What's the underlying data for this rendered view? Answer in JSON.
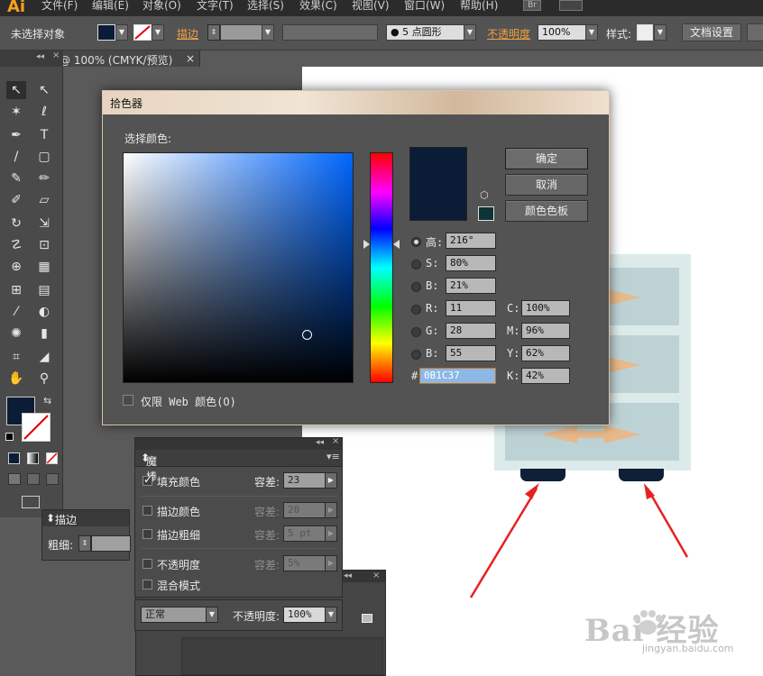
{
  "app": {
    "logo": "Ai"
  },
  "menu": [
    "文件(F)",
    "编辑(E)",
    "对象(O)",
    "文字(T)",
    "选择(S)",
    "效果(C)",
    "视图(V)",
    "窗口(W)",
    "帮助(H)"
  ],
  "bridge_button": "Br",
  "control_bar": {
    "selection_status": "未选择对象",
    "stroke_label": "描边",
    "brush_size_value": "5",
    "brush_shape": "点圆形",
    "opacity_label": "不透明度",
    "opacity_value": "100%",
    "style_label": "样式:",
    "doc_settings_button": "文档设置"
  },
  "document_tab": {
    "title": "@ 100% (CMYK/预览)",
    "close": "×"
  },
  "color_picker": {
    "title": "拾色器",
    "select_color_label": "选择颜色:",
    "buttons": {
      "ok": "确定",
      "cancel": "取消",
      "swatches": "颜色色板"
    },
    "hsb": [
      {
        "label": "高:",
        "value": "216°",
        "selected": true
      },
      {
        "label": "S:",
        "value": "80%",
        "selected": false
      },
      {
        "label": "B:",
        "value": "21%",
        "selected": false
      }
    ],
    "rgb": [
      {
        "label": "R:",
        "value": "11"
      },
      {
        "label": "G:",
        "value": "28"
      },
      {
        "label": "B:",
        "value": "55"
      }
    ],
    "cmyk": [
      {
        "label": "C:",
        "value": "100%"
      },
      {
        "label": "M:",
        "value": "96%"
      },
      {
        "label": "Y:",
        "value": "62%"
      },
      {
        "label": "K:",
        "value": "42%"
      }
    ],
    "hex_label": "#",
    "hex_value": "0B1C37",
    "web_only_label": "仅限 Web 颜色(O)",
    "current_color": "#0b1c37"
  },
  "magic_wand": {
    "title": "魔棒",
    "rows": [
      {
        "label": "填充颜色",
        "checked": true,
        "tolerance_label": "容差:",
        "tolerance": "23"
      },
      {
        "label": "描边颜色",
        "checked": false,
        "tolerance_label": "容差:",
        "tolerance": "20"
      },
      {
        "label": "描边粗细",
        "checked": false,
        "tolerance_label": "容差:",
        "tolerance": "5 pt"
      },
      {
        "label": "不透明度",
        "checked": false,
        "tolerance_label": "容差:",
        "tolerance": "5%"
      },
      {
        "label": "混合模式",
        "checked": false
      }
    ],
    "blend_mode": "正常",
    "opacity_label": "不透明度:",
    "opacity_value": "100%"
  },
  "stroke_panel": {
    "title": "描边",
    "weight_label": "粗细:"
  },
  "watermark": {
    "text": "Bai 经验",
    "url": "jingyan.baidu.com"
  }
}
